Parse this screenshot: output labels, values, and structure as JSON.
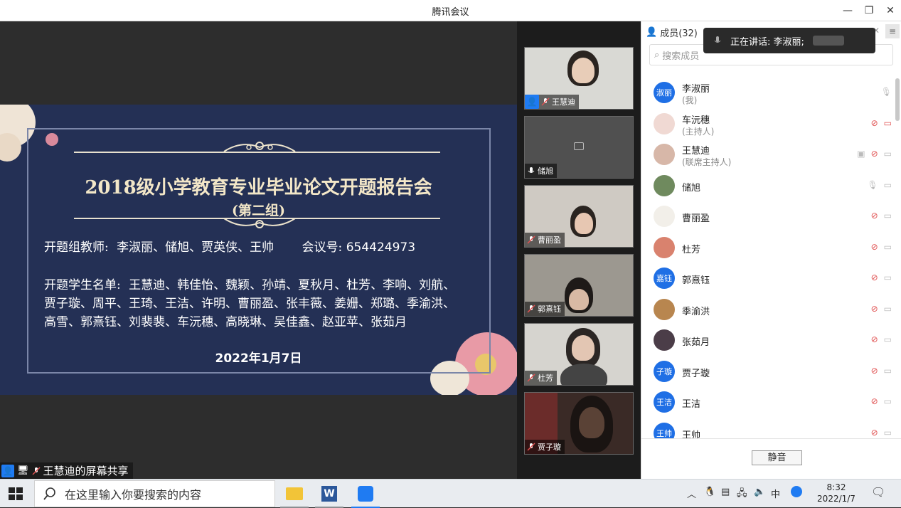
{
  "window": {
    "title": "腾讯会议"
  },
  "slide": {
    "title": "2018级小学教育专业毕业论文开题报告会",
    "subtitle": "(第二组)",
    "teachers_label": "开题组教师:",
    "teachers": "李淑丽、储旭、贾英侠、王帅",
    "meeting_no_label": "会议号:",
    "meeting_no": "654424973",
    "students_label": "开题学生名单:",
    "students_line1": "王慧迪、韩佳怡、魏颖、孙靖、夏秋月、杜芳、李响、刘航、",
    "students_line2": "贾子璇、周平、王琦、王洁、许明、曹丽盈、张丰薇、姜姗、郑璐、季渝洪、",
    "students_line3": "高雪、郭熹钰、刘裴裴、车沅穗、高晓琳、吴佳鑫、赵亚苹、张茹月",
    "date": "2022年1月7日"
  },
  "share_label": "王慧迪的屏幕共享",
  "video_tiles": [
    {
      "name": "王慧迪"
    },
    {
      "name": "储旭"
    },
    {
      "name": "曹丽盈"
    },
    {
      "name": "郭熹钰"
    },
    {
      "name": "杜芳"
    },
    {
      "name": "贾子璇"
    }
  ],
  "panel": {
    "members_label": "成员(32)",
    "speaking_label": "正在讲话: 李淑丽;",
    "search_placeholder": "搜索成员",
    "mute_all": "静音",
    "members": [
      {
        "avatar": "淑丽",
        "name": "李淑丽",
        "role": "(我)"
      },
      {
        "avatar": "",
        "name": "车沅穗",
        "role": "(主持人)"
      },
      {
        "avatar": "",
        "name": "王慧迪",
        "role": "(联席主持人)"
      },
      {
        "avatar": "",
        "name": "储旭",
        "role": ""
      },
      {
        "avatar": "",
        "name": "曹丽盈",
        "role": ""
      },
      {
        "avatar": "",
        "name": "杜芳",
        "role": ""
      },
      {
        "avatar": "嘉钰",
        "name": "郭熹钰",
        "role": ""
      },
      {
        "avatar": "",
        "name": "季渝洪",
        "role": ""
      },
      {
        "avatar": "",
        "name": "张茹月",
        "role": ""
      },
      {
        "avatar": "子璇",
        "name": "贾子璇",
        "role": ""
      },
      {
        "avatar": "王洁",
        "name": "王洁",
        "role": ""
      },
      {
        "avatar": "王帅",
        "name": "王帅",
        "role": ""
      }
    ]
  },
  "taskbar": {
    "search_placeholder": "在这里输入你要搜索的内容",
    "ime": "中",
    "time": "8:32",
    "date": "2022/1/7"
  },
  "colors": {
    "accent": "#1f6fe5",
    "slide_bg": "#243055",
    "muted_red": "#e05050"
  }
}
